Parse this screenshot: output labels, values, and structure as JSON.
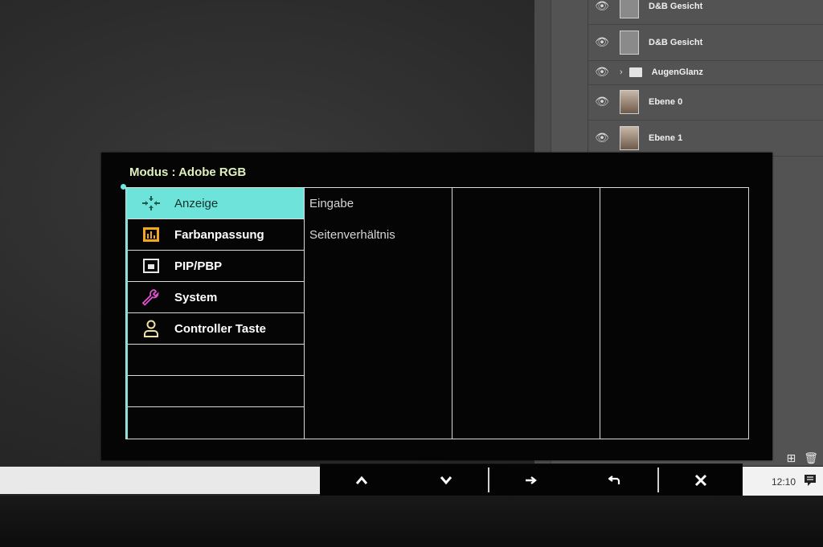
{
  "background_app": {
    "layers": [
      {
        "name": "D&B Gesicht",
        "thumb": "plain"
      },
      {
        "name": "D&B Gesicht",
        "thumb": "plain"
      },
      {
        "name": "AugenGlanz",
        "thumb": "folder"
      },
      {
        "name": "Ebene 0",
        "thumb": "face"
      },
      {
        "name": "Ebene 1",
        "thumb": "face"
      }
    ],
    "bottom_icons": [
      "new-layer-icon",
      "trash-icon"
    ]
  },
  "taskbar": {
    "clock": "12:10",
    "notification_icon": "notification-icon"
  },
  "osd": {
    "mode_title": "Modus : Adobe RGB",
    "accent_color": "#6de3da",
    "menu": [
      {
        "label": "Anzeige",
        "icon": "display-arrows-icon",
        "active": true
      },
      {
        "label": "Farbanpassung",
        "icon": "color-adjust-icon",
        "active": false
      },
      {
        "label": "PIP/PBP",
        "icon": "pip-icon",
        "active": false
      },
      {
        "label": "System",
        "icon": "wrench-icon",
        "active": false
      },
      {
        "label": "Controller Taste",
        "icon": "person-icon",
        "active": false
      }
    ],
    "submenu": [
      {
        "label": "Eingabe"
      },
      {
        "label": "Seitenverhältnis"
      }
    ],
    "keys": [
      {
        "glyph": "▲",
        "icon": "up-arrow-icon"
      },
      {
        "glyph": "▼",
        "icon": "down-arrow-icon"
      },
      {
        "glyph": "→",
        "icon": "right-arrow-icon"
      },
      {
        "glyph": "⮌",
        "icon": "return-icon"
      },
      {
        "glyph": "✕",
        "icon": "close-icon"
      }
    ]
  }
}
